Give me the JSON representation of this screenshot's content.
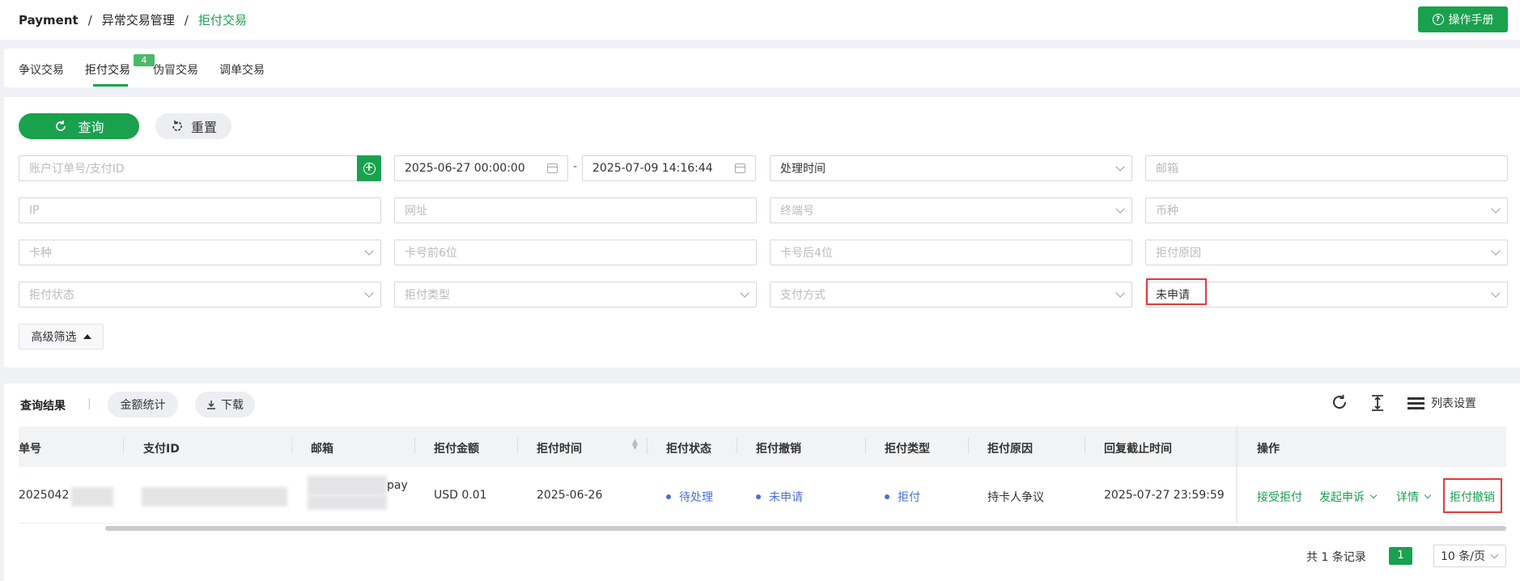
{
  "breadcrumb": {
    "root": "Payment",
    "sep": "/",
    "parent": "异常交易管理",
    "current": "拒付交易"
  },
  "header": {
    "manual_label": "操作手册"
  },
  "tabs": [
    {
      "label": "争议交易"
    },
    {
      "label": "拒付交易",
      "badge": "4"
    },
    {
      "label": "伪冒交易"
    },
    {
      "label": "调单交易"
    }
  ],
  "filters": {
    "query_label": "查询",
    "reset_label": "重置",
    "order_placeholder": "账户订单号/支付ID",
    "date_start": "2025-06-27 00:00:00",
    "date_sep": "-",
    "date_end": "2025-07-09 14:16:44",
    "time_type": "处理时间",
    "email_placeholder": "邮箱",
    "ip_placeholder": "IP",
    "url_placeholder": "网址",
    "terminal_placeholder": "终端号",
    "currency_placeholder": "币种",
    "card_type_placeholder": "卡种",
    "card_prefix_placeholder": "卡号前6位",
    "card_suffix_placeholder": "卡号后4位",
    "reason_placeholder": "拒付原因",
    "status_placeholder": "拒付状态",
    "type_placeholder": "拒付类型",
    "pay_method_placeholder": "支付方式",
    "revoke_value": "未申请",
    "advanced_label": "高级筛选"
  },
  "results": {
    "title": "查询结果",
    "stats_label": "金额统计",
    "download_label": "下载",
    "column_settings_label": "列表设置",
    "columns": [
      "单号",
      "支付ID",
      "邮箱",
      "拒付金额",
      "拒付时间",
      "拒付状态",
      "拒付撤销",
      "拒付类型",
      "拒付原因",
      "回复截止时间",
      "操作"
    ],
    "row": {
      "order_no": "2025042",
      "email_suffix": "pay",
      "amount": "USD 0.01",
      "time": "2025-06-26",
      "status": "待处理",
      "revoke": "未申请",
      "type": "拒付",
      "reason": "持卡人争议",
      "deadline": "2025-07-27 23:59:59"
    },
    "actions": [
      "接受拒付",
      "发起申诉",
      "详情",
      "拒付撤销"
    ]
  },
  "pagination": {
    "total_prefix": "共",
    "total_count": "1",
    "total_suffix": "条记录",
    "current_page": "1",
    "page_size": "10 条/页"
  }
}
